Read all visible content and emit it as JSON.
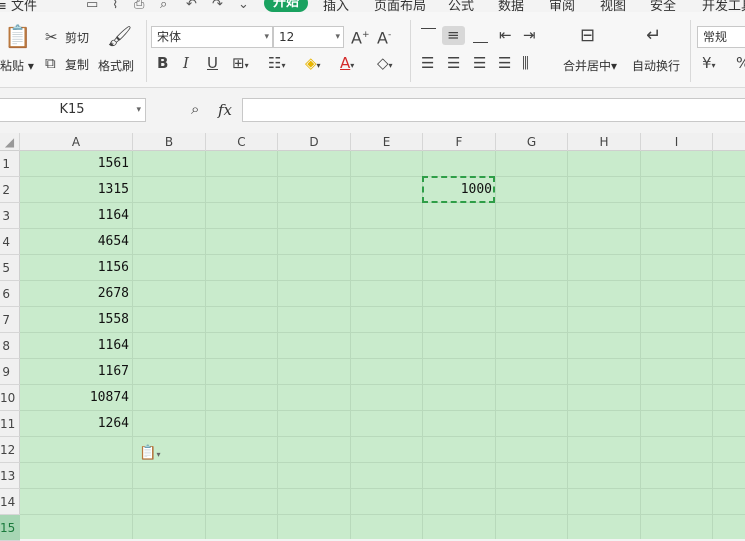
{
  "menu": {
    "file": "≡ 文件",
    "tabs": [
      {
        "label": "开始",
        "active": true
      },
      {
        "label": "插入",
        "active": false
      },
      {
        "label": "页面布局",
        "active": false
      },
      {
        "label": "公式",
        "active": false
      },
      {
        "label": "数据",
        "active": false
      },
      {
        "label": "审阅",
        "active": false
      },
      {
        "label": "视图",
        "active": false
      },
      {
        "label": "安全",
        "active": false
      },
      {
        "label": "开发工具",
        "active": false
      }
    ]
  },
  "ribbon": {
    "paste": "粘贴",
    "cut": "剪切",
    "copy": "复制",
    "format_painter": "格式刷",
    "font_name": "宋体",
    "font_size": "12",
    "merge_center": "合并居中",
    "wrap_text": "自动换行",
    "number_format": "常规"
  },
  "formula_bar": {
    "name_box": "K15",
    "fx": "fx",
    "value": ""
  },
  "sheet": {
    "columns": [
      "A",
      "B",
      "C",
      "D",
      "E",
      "F",
      "G",
      "H",
      "I"
    ],
    "rows": [
      "1",
      "2",
      "3",
      "4",
      "5",
      "6",
      "7",
      "8",
      "9",
      "10",
      "11",
      "12",
      "13",
      "14",
      "15"
    ],
    "column_a_values": [
      "1561",
      "1315",
      "1164",
      "4654",
      "1156",
      "2678",
      "1558",
      "1164",
      "1167",
      "10874",
      "1264"
    ],
    "f2_value": "1000",
    "selected_row": "15"
  },
  "colors": {
    "accent": "#1aa260",
    "grid_bg": "#c9ebcc",
    "copy_border": "#2e9e47"
  }
}
